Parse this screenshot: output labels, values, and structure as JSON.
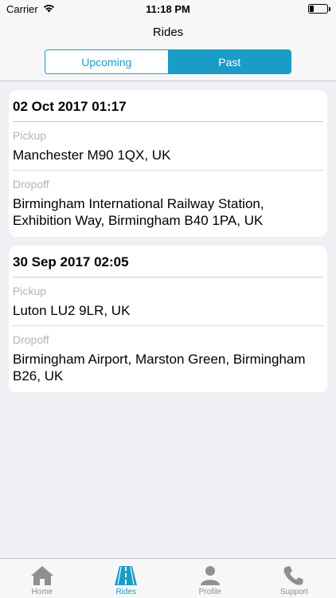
{
  "status": {
    "carrier": "Carrier",
    "time": "11:18 PM",
    "battery_level": 0.25
  },
  "nav": {
    "title": "Rides",
    "segments": [
      {
        "label": "Upcoming",
        "selected": false
      },
      {
        "label": "Past",
        "selected": true
      }
    ]
  },
  "rides": [
    {
      "date": "02 Oct 2017 01:17",
      "pickup_label": "Pickup",
      "pickup": "Manchester M90 1QX, UK",
      "dropoff_label": "Dropoff",
      "dropoff": "Birmingham International Railway Station, Exhibition Way, Birmingham B40 1PA, UK"
    },
    {
      "date": "30 Sep 2017 02:05",
      "pickup_label": "Pickup",
      "pickup": "Luton LU2 9LR, UK",
      "dropoff_label": "Dropoff",
      "dropoff": "Birmingham Airport, Marston Green, Birmingham B26, UK"
    }
  ],
  "tabs": [
    {
      "label": "Home",
      "icon": "home-icon",
      "selected": false
    },
    {
      "label": "Rides",
      "icon": "road-icon",
      "selected": true
    },
    {
      "label": "Profile",
      "icon": "person-icon",
      "selected": false
    },
    {
      "label": "Support",
      "icon": "phone-icon",
      "selected": false
    }
  ],
  "colors": {
    "accent": "#1a9cc7",
    "background": "#efeff4",
    "inactive_icon": "#8e8e93"
  }
}
